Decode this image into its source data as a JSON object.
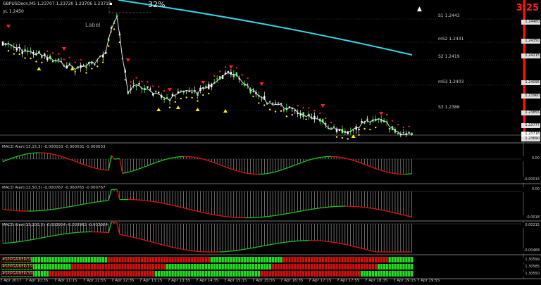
{
  "header": {
    "symbol_line": "GBPUSDecn,M5  1.23707 1.23720 1.23706 1.23718",
    "yl": "yL 1.2450",
    "object_label": "Label",
    "percent": "32%",
    "timer": "3:25"
  },
  "pivots": [
    {
      "label": "S1 1.2443",
      "price": 1.2443
    },
    {
      "label": "mS2 1.2431",
      "price": 1.2431
    },
    {
      "label": "S2 1.2419",
      "price": 1.2419
    },
    {
      "label": "mS3 1.2403",
      "price": 1.2403
    },
    {
      "label": "S3 1.2386",
      "price": 1.2386
    }
  ],
  "price_scale": [
    "1.24480",
    "1.24350",
    "1.24215",
    "1.24095",
    "1.23960",
    "1.23855",
    "1.23777",
    "1.23718",
    "1.23690"
  ],
  "current_price": "1.23718",
  "indicators": [
    {
      "title": "MACD Alert(13,15,3) -0.000033 -0.000031 -0.000033",
      "scale_top": "0.00",
      "scale_mid": "0.00",
      "scale_bottom": "-0.00015"
    },
    {
      "title": "MACD Alert(13,50,3) -0.000767 -0.000765 -0.000767",
      "scale_top": "0.00",
      "scale_bottom": "-0.0018"
    },
    {
      "title": "MACD Alert(13,200,3) -0.003904 -0.003962 -0.003904",
      "scale_top": "0.00215",
      "scale_bottom": "-0.00468"
    }
  ],
  "bar_rows": [
    {
      "title": "#SPIPGAINER(5)",
      "value": "1.30599"
    },
    {
      "title": "#SPIPGAINER(15)",
      "value": "1.30585"
    },
    {
      "title": "#SPIPGAINER(30)",
      "value": "1.30550"
    }
  ],
  "time_axis": [
    "7 Apr 2017",
    "7 Apr 10:35",
    "7 Apr 11:15",
    "7 Apr 11:55",
    "7 Apr 12:35",
    "7 Apr 13:15",
    "7 Apr 13:55",
    "7 Apr 14:35",
    "7 Apr 15:15",
    "7 Apr 15:55",
    "7 Apr 16:35",
    "7 Apr 17:15",
    "7 Apr 17:55",
    "7 Apr 18:35",
    "7 Apr 19:15",
    "7 Apr 19:55"
  ],
  "colors": {
    "bull": "#66ff66",
    "bear": "#ffffff",
    "ma": "#e0e0e0",
    "slow_ma": "#33d6e6",
    "arrow_down": "#ff2020",
    "arrow_up": "#ffee00",
    "macd_green": "#20c020",
    "macd_red": "#e01010",
    "bar_green": "#20e020",
    "bar_red": "#d01010",
    "scale_red": "#ff1010"
  }
}
